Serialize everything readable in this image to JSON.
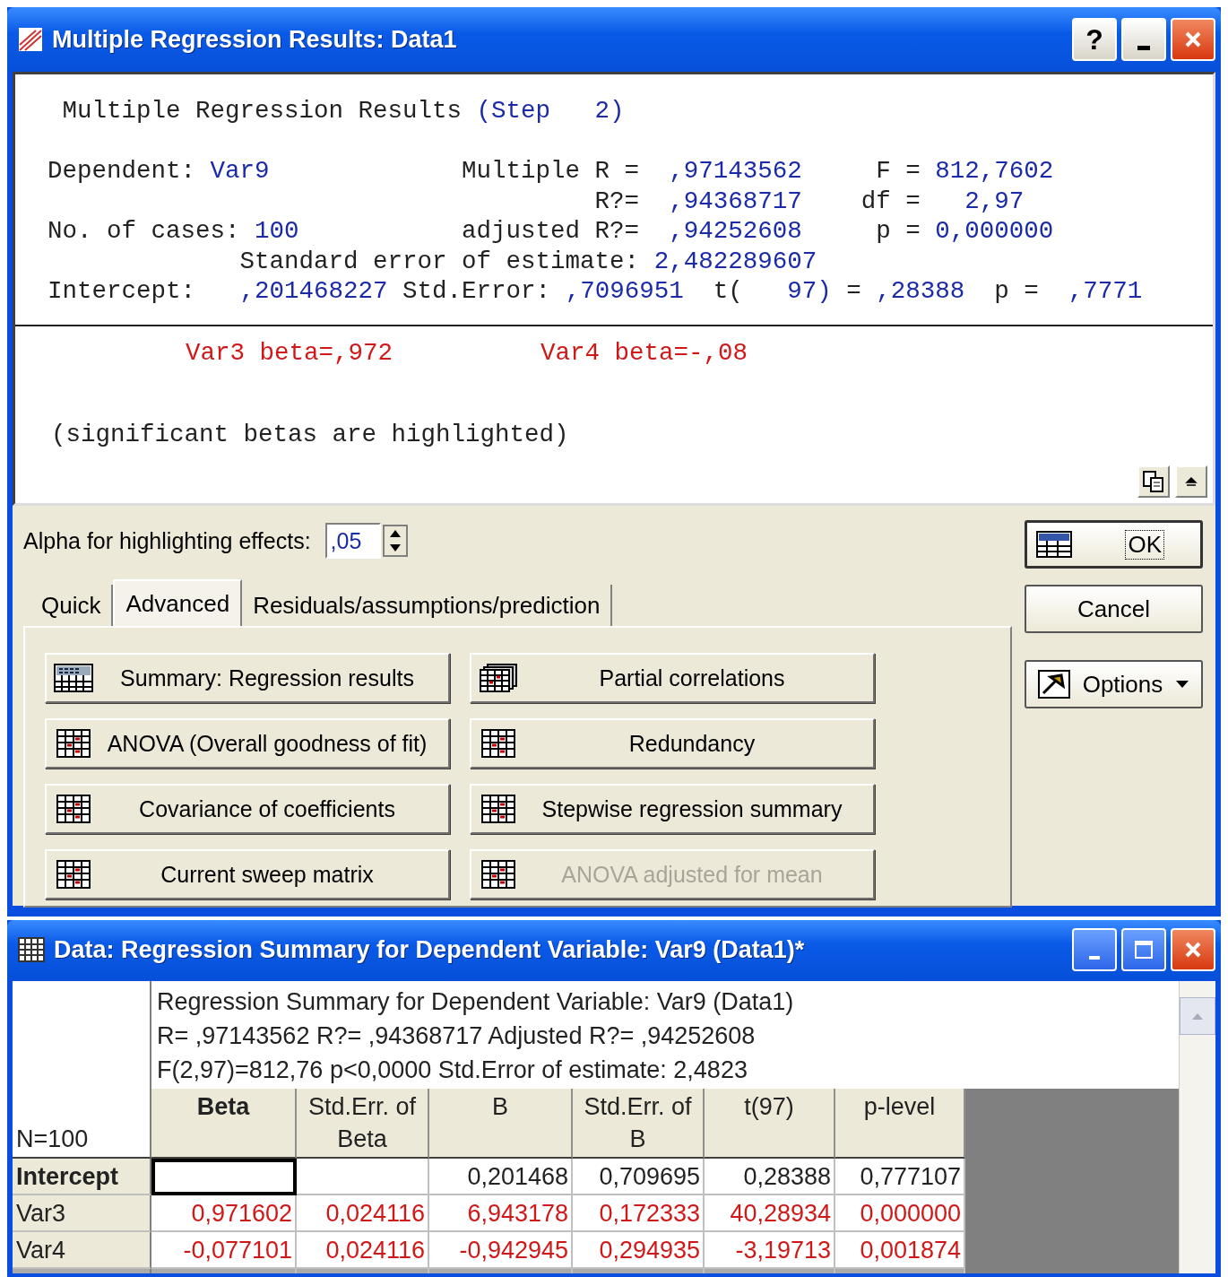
{
  "results_window": {
    "title": "Multiple Regression Results: Data1",
    "help_button": "?",
    "report": {
      "lines": [
        [
          {
            "kind": "label",
            "text": " Multiple Regression Results "
          },
          {
            "kind": "value",
            "text": "(Step   2)"
          }
        ],
        [
          {
            "kind": "label",
            "text": "Dependent: "
          },
          {
            "kind": "value",
            "text": "Var9"
          },
          {
            "kind": "label",
            "text": "             Multiple R =  "
          },
          {
            "kind": "value",
            "text": ",97143562"
          },
          {
            "kind": "label",
            "text": "     F = "
          },
          {
            "kind": "value",
            "text": "812,7602"
          }
        ],
        [
          {
            "kind": "label",
            "text": "                                     R?=  "
          },
          {
            "kind": "value",
            "text": ",94368717"
          },
          {
            "kind": "label",
            "text": "    df =   "
          },
          {
            "kind": "value",
            "text": "2,97"
          }
        ],
        [
          {
            "kind": "label",
            "text": "No. of cases: "
          },
          {
            "kind": "value",
            "text": "100"
          },
          {
            "kind": "label",
            "text": "           adjusted R?=  "
          },
          {
            "kind": "value",
            "text": ",94252608"
          },
          {
            "kind": "label",
            "text": "     p = "
          },
          {
            "kind": "value",
            "text": "0,000000"
          }
        ],
        [
          {
            "kind": "label",
            "text": "             Standard error of estimate: "
          },
          {
            "kind": "value",
            "text": "2,482289607"
          }
        ],
        [
          {
            "kind": "label",
            "text": "Intercept:   "
          },
          {
            "kind": "value",
            "text": ",201468227"
          },
          {
            "kind": "label",
            "text": " Std.Error: "
          },
          {
            "kind": "value",
            "text": ",7096951"
          },
          {
            "kind": "label",
            "text": "  t(   "
          },
          {
            "kind": "value",
            "text": "97)"
          },
          {
            "kind": "label",
            "text": " = "
          },
          {
            "kind": "value",
            "text": ",28388"
          },
          {
            "kind": "label",
            "text": "  p =  "
          },
          {
            "kind": "value",
            "text": ",7771"
          }
        ]
      ],
      "betas": [
        {
          "text": "Var3 beta=,972",
          "highlighted": true
        },
        {
          "text": "Var4 beta=-,08",
          "highlighted": true
        }
      ],
      "note": "(significant betas are highlighted)"
    },
    "alpha": {
      "label": "Alpha for highlighting effects:",
      "value": ",05"
    },
    "tabs": [
      {
        "label": "Quick",
        "selected": false
      },
      {
        "label": "Advanced",
        "selected": true
      },
      {
        "label": "Residuals/assumptions/prediction",
        "selected": false
      }
    ],
    "buttons": [
      {
        "label": "Summary:  Regression results",
        "disabled": false
      },
      {
        "label": "Partial correlations",
        "disabled": false
      },
      {
        "label": "ANOVA (Overall goodness of fit)",
        "disabled": false
      },
      {
        "label": "Redundancy",
        "disabled": false
      },
      {
        "label": "Covariance of coefficients",
        "disabled": false
      },
      {
        "label": "Stepwise regression summary",
        "disabled": false
      },
      {
        "label": "Current sweep matrix",
        "disabled": false
      },
      {
        "label": "ANOVA adjusted for mean",
        "disabled": true
      }
    ],
    "side_buttons": [
      {
        "kind": "ok",
        "label": "OK"
      },
      {
        "kind": "cancel",
        "label": "Cancel"
      },
      {
        "kind": "options",
        "label": "Options"
      }
    ]
  },
  "data_window": {
    "title": "Data: Regression Summary for Dependent Variable: Var9 (Data1)*",
    "title_lines": [
      "Regression Summary for Dependent Variable: Var9 (Data1)",
      "R= ,97143562 R?= ,94368717 Adjusted R?= ,94252608",
      "F(2,97)=812,76 p<0,0000 Std.Error of estimate: 2,4823"
    ],
    "corner": "N=100",
    "columns": [
      {
        "label": "Beta",
        "bold": true
      },
      {
        "label": "Std.Err. of Beta",
        "bold": false
      },
      {
        "label": "B",
        "bold": false
      },
      {
        "label": "Std.Err. of B",
        "bold": false
      },
      {
        "label": "t(97)",
        "bold": false
      },
      {
        "label": "p-level",
        "bold": false
      }
    ],
    "rows": [
      {
        "label": "Intercept",
        "bold": true,
        "highlighted": false,
        "cells": [
          {
            "selected": true
          },
          {
            "selected": false
          },
          {
            "value": "0,201468",
            "selected": false
          },
          {
            "value": "0,709695",
            "selected": false
          },
          {
            "value": "0,28388",
            "selected": false
          },
          {
            "value": "0,777107",
            "selected": false
          }
        ]
      },
      {
        "label": "Var3",
        "bold": false,
        "highlighted": true,
        "cells": [
          {
            "value": "0,971602",
            "selected": false
          },
          {
            "value": "0,024116",
            "selected": false
          },
          {
            "value": "6,943178",
            "selected": false
          },
          {
            "value": "0,172333",
            "selected": false
          },
          {
            "value": "40,28934",
            "selected": false
          },
          {
            "value": "0,000000",
            "selected": false
          }
        ]
      },
      {
        "label": "Var4",
        "bold": false,
        "highlighted": true,
        "cells": [
          {
            "value": "-0,077101",
            "selected": false
          },
          {
            "value": "0,024116",
            "selected": false
          },
          {
            "value": "-0,942945",
            "selected": false
          },
          {
            "value": "0,294935",
            "selected": false
          },
          {
            "value": "-3,19713",
            "selected": false
          },
          {
            "value": "0,001874",
            "selected": false
          }
        ]
      }
    ]
  }
}
